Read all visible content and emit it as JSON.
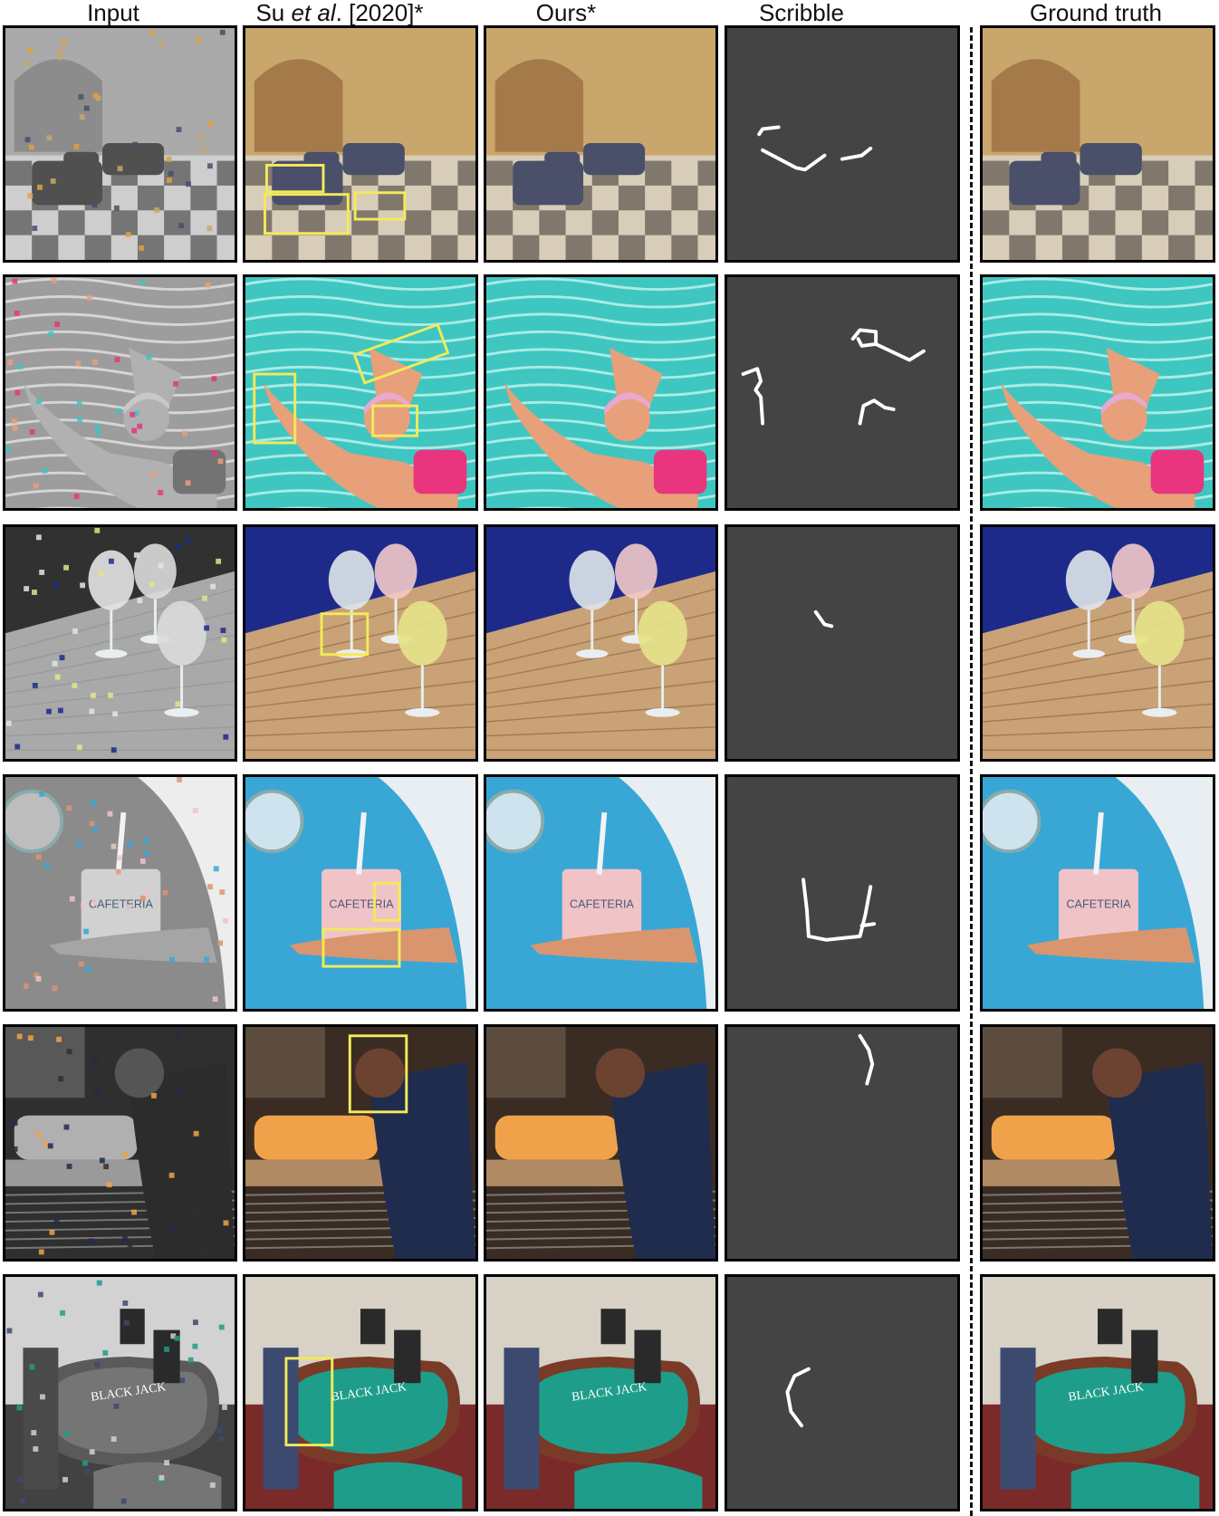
{
  "headers": {
    "input": "Input",
    "su_prefix": "Su ",
    "su_etal": "et al",
    "su_suffix": ". [2020]*",
    "ours": "Ours*",
    "scribble": "Scribble",
    "ground_truth": "Ground truth"
  },
  "scenes": [
    {
      "name": "hotel-lobby",
      "colors": {
        "sky": "#c9a66b",
        "floor": "#d8cdb8",
        "object": "#4a4f6a",
        "accent": "#e1a03d"
      }
    },
    {
      "name": "swimmer",
      "colors": {
        "sky": "#3fc6c0",
        "floor": "#7fe0d8",
        "object": "#e7a07a",
        "accent": "#e8357e"
      }
    },
    {
      "name": "glasses-on-table",
      "colors": {
        "sky": "#1d2a8a",
        "floor": "#c9a277",
        "object": "#dfe6ea",
        "accent": "#e7e38a"
      }
    },
    {
      "name": "cafeteria-cup",
      "colors": {
        "sky": "#38a7d6",
        "floor": "#e8eef1",
        "object": "#f0c3c7",
        "accent": "#d9956e"
      }
    },
    {
      "name": "baker-oven",
      "colors": {
        "sky": "#3a2c23",
        "floor": "#8a5a36",
        "object": "#1f2c4e",
        "accent": "#f0a24a"
      }
    },
    {
      "name": "blackjack-table",
      "colors": {
        "sky": "#d7d1c6",
        "floor": "#7b2a2a",
        "object": "#1e9e8a",
        "accent": "#3c4a70"
      }
    }
  ],
  "table_text": {
    "game_name": "BLACK JACK",
    "cup_brand": "CAFETERIA"
  },
  "colors": {
    "highlight_box": "#f2ea5a",
    "scribble_bg": "#444444",
    "scribble_stroke": "#ffffff",
    "panel_border": "#000000"
  }
}
